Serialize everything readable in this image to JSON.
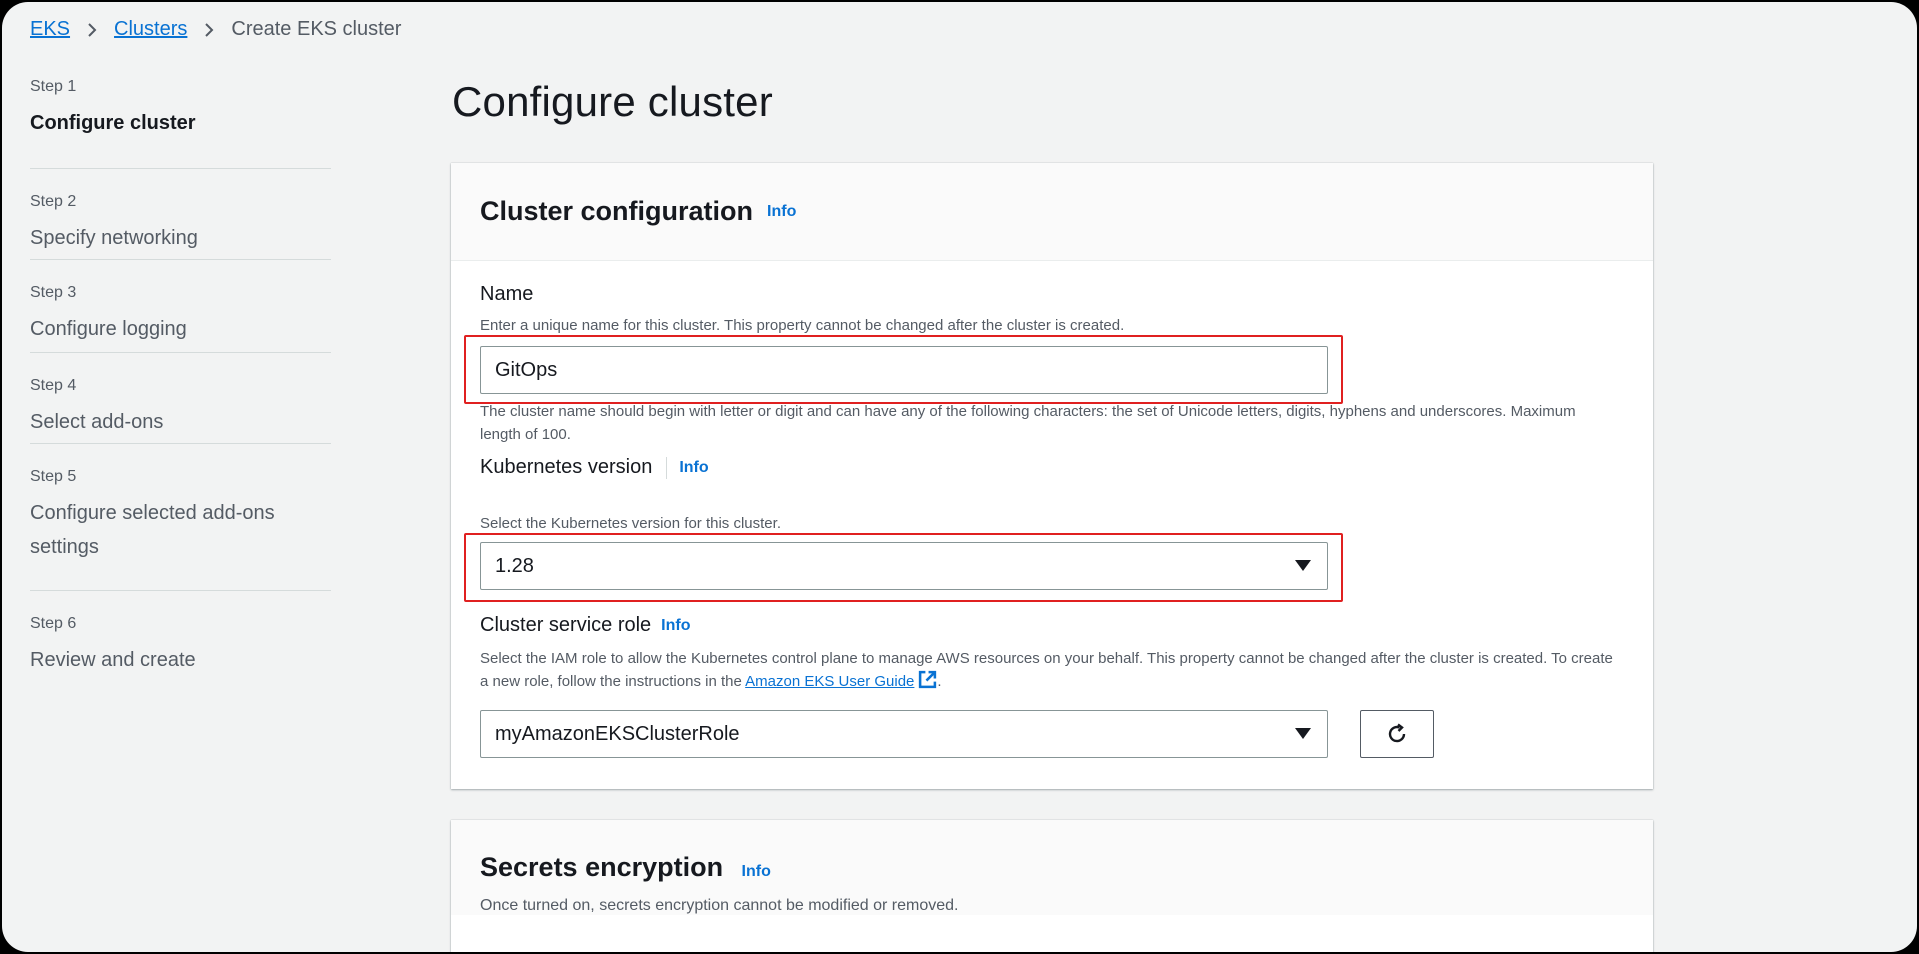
{
  "breadcrumb": {
    "items": [
      "EKS",
      "Clusters"
    ],
    "current": "Create EKS cluster"
  },
  "steps": [
    {
      "number": "Step 1",
      "title": "Configure cluster",
      "active": true
    },
    {
      "number": "Step 2",
      "title": "Specify networking"
    },
    {
      "number": "Step 3",
      "title": "Configure logging"
    },
    {
      "number": "Step 4",
      "title": "Select add-ons"
    },
    {
      "number": "Step 5",
      "title": "Configure selected add-ons settings"
    },
    {
      "number": "Step 6",
      "title": "Review and create"
    }
  ],
  "page_title": "Configure cluster",
  "cluster_config": {
    "title": "Cluster configuration",
    "info": "Info",
    "name": {
      "label": "Name",
      "description": "Enter a unique name for this cluster. This property cannot be changed after the cluster is created.",
      "value": "GitOps",
      "constraint": "The cluster name should begin with letter or digit and can have any of the following characters: the set of Unicode letters, digits, hyphens and underscores. Maximum length of 100."
    },
    "k8s_version": {
      "label": "Kubernetes version",
      "info": "Info",
      "description": "Select the Kubernetes version for this cluster.",
      "value": "1.28"
    },
    "service_role": {
      "label": "Cluster service role",
      "info": "Info",
      "description": "Select the IAM role to allow the Kubernetes control plane to manage AWS resources on your behalf. This property cannot be changed after the cluster is created. To create a new role, follow the instructions in the",
      "link": "Amazon EKS User Guide",
      "link_suffix": ".",
      "value": "myAmazonEKSClusterRole"
    }
  },
  "secrets": {
    "title": "Secrets encryption",
    "info": "Info",
    "description": "Once turned on, secrets encryption cannot be modified or removed."
  },
  "colors": {
    "link": "#0972d3",
    "highlight": "#e02020",
    "background": "#f2f3f3"
  },
  "icons": {
    "breadcrumb_separator": "chevron-right-icon",
    "dropdown": "caret-down-icon",
    "refresh": "refresh-icon",
    "external_link": "external-link-icon"
  }
}
